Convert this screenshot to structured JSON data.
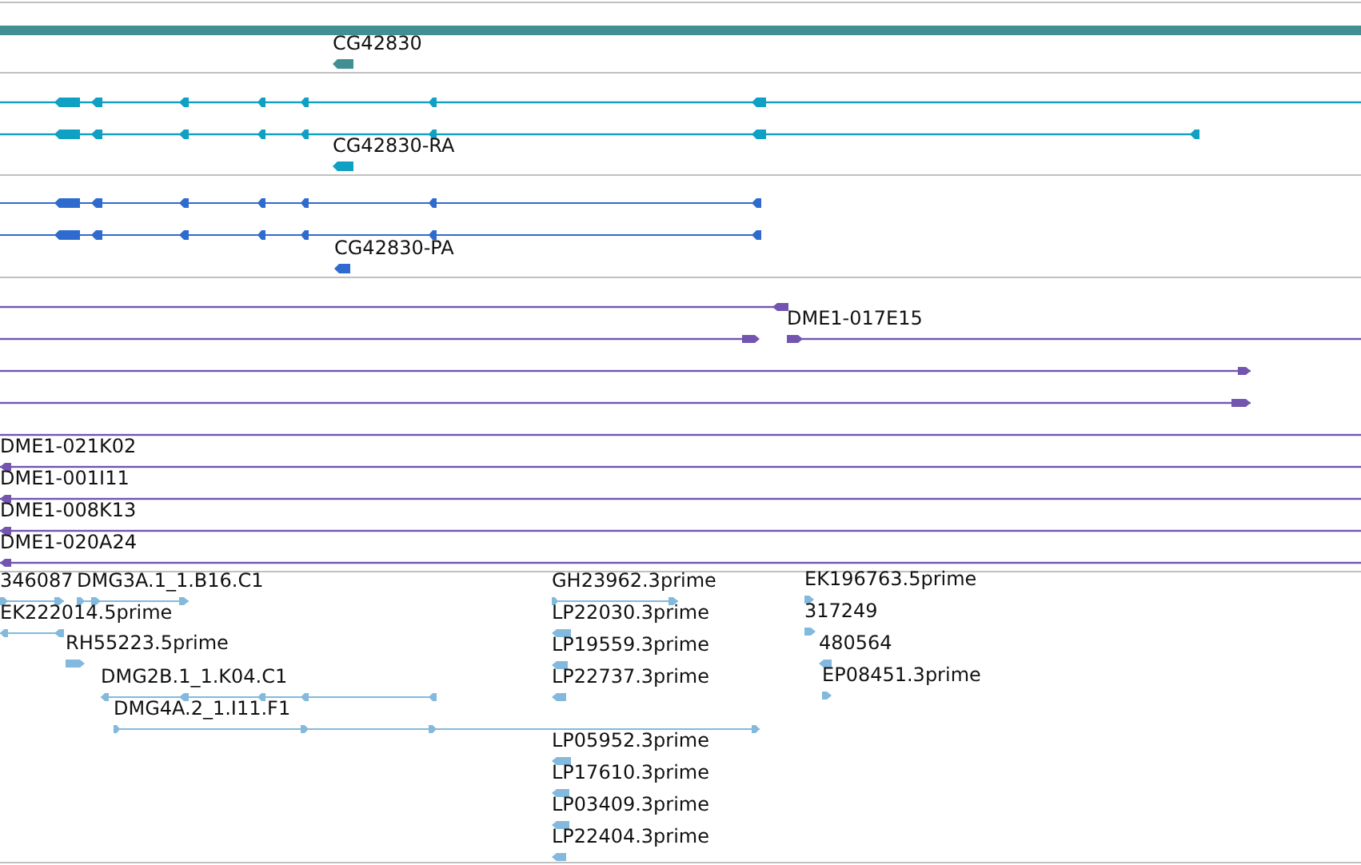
{
  "tracks": [
    {
      "kind": "gene",
      "color": "#418f92",
      "features": [
        {
          "reverse": true
        },
        {
          "label": "CG42830",
          "reverse": true
        }
      ]
    },
    {
      "kind": "mrna",
      "color": "#0fa0c3",
      "features": [
        {
          "reverse": true
        },
        {
          "reverse": true
        },
        {
          "label": "CG42830-RA",
          "reverse": true
        }
      ]
    },
    {
      "kind": "cds",
      "color": "#2f6bcf",
      "features": [
        {
          "reverse": true
        },
        {
          "reverse": true
        },
        {
          "label": "CG42830-PA",
          "reverse": true
        }
      ]
    },
    {
      "kind": "clone",
      "color": "#7355b0",
      "features": [
        {
          "reverse": true
        },
        {
          "reverse": false
        },
        {
          "label": "DME1-017E15",
          "reverse": false
        },
        {
          "reverse": false
        },
        {
          "reverse": false
        },
        {
          "label": "DME1-021K02",
          "reverse": true
        },
        {
          "label": "DME1-001I11",
          "reverse": true
        },
        {
          "label": "DME1-008K13",
          "reverse": true
        },
        {
          "label": "DME1-020A24",
          "reverse": true
        }
      ]
    },
    {
      "kind": "est",
      "color": "#82b9dd",
      "features": [
        {
          "label": "346087",
          "reverse": false
        },
        {
          "label": "DMG3A.1_1.B16.C1",
          "reverse": false
        },
        {
          "label": "EK222014.5prime",
          "reverse": true
        },
        {
          "label": "RH55223.5prime",
          "reverse": false
        },
        {
          "label": "DMG2B.1_1.K04.C1",
          "reverse": true
        },
        {
          "label": "DMG4A.2_1.I11.F1",
          "reverse": false
        },
        {
          "label": "GH23962.3prime",
          "reverse": false
        },
        {
          "label": "LP22030.3prime",
          "reverse": true
        },
        {
          "label": "LP19559.3prime",
          "reverse": true
        },
        {
          "label": "LP22737.3prime",
          "reverse": true
        },
        {
          "label": "LP05952.3prime",
          "reverse": true
        },
        {
          "label": "LP17610.3prime",
          "reverse": true
        },
        {
          "label": "LP03409.3prime",
          "reverse": true
        },
        {
          "label": "LP22404.3prime",
          "reverse": true
        },
        {
          "label": "EK196763.5prime",
          "reverse": false
        },
        {
          "label": "317249",
          "reverse": false
        },
        {
          "label": "480564",
          "reverse": true
        },
        {
          "label": "EP08451.3prime",
          "reverse": false
        }
      ]
    }
  ]
}
